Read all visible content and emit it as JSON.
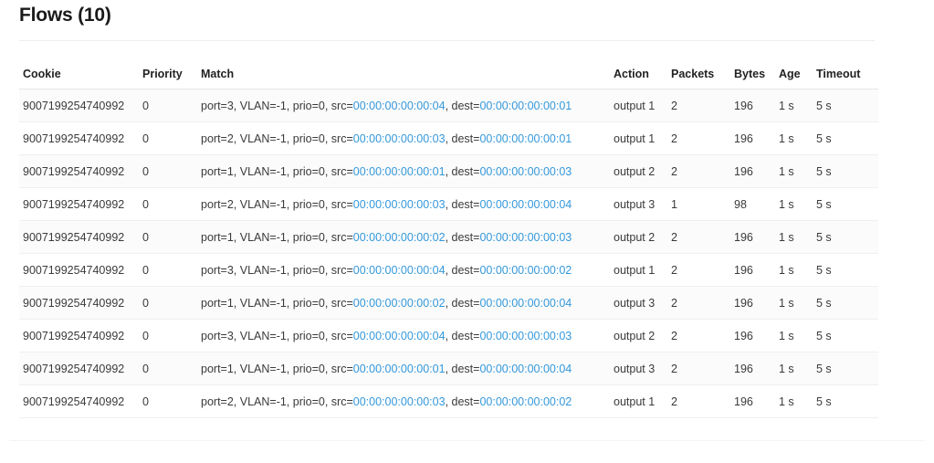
{
  "page": {
    "title": "Flows (10)"
  },
  "table": {
    "columns": [
      {
        "key": "cookie",
        "label": "Cookie"
      },
      {
        "key": "priority",
        "label": "Priority"
      },
      {
        "key": "match",
        "label": "Match"
      },
      {
        "key": "action",
        "label": "Action"
      },
      {
        "key": "packets",
        "label": "Packets"
      },
      {
        "key": "bytes",
        "label": "Bytes"
      },
      {
        "key": "age",
        "label": "Age"
      },
      {
        "key": "timeout",
        "label": "Timeout"
      }
    ],
    "rows": [
      {
        "cookie": "9007199254740992",
        "priority": "0",
        "match_prefix": "port=3, VLAN=-1, prio=0, src=",
        "match_src": "00:00:00:00:00:04",
        "match_mid": ", dest=",
        "match_dest": "00:00:00:00:00:01",
        "action": "output 1",
        "packets": "2",
        "bytes": "196",
        "age": "1 s",
        "timeout": "5 s"
      },
      {
        "cookie": "9007199254740992",
        "priority": "0",
        "match_prefix": "port=2, VLAN=-1, prio=0, src=",
        "match_src": "00:00:00:00:00:03",
        "match_mid": ", dest=",
        "match_dest": "00:00:00:00:00:01",
        "action": "output 1",
        "packets": "2",
        "bytes": "196",
        "age": "1 s",
        "timeout": "5 s"
      },
      {
        "cookie": "9007199254740992",
        "priority": "0",
        "match_prefix": "port=1, VLAN=-1, prio=0, src=",
        "match_src": "00:00:00:00:00:01",
        "match_mid": ", dest=",
        "match_dest": "00:00:00:00:00:03",
        "action": "output 2",
        "packets": "2",
        "bytes": "196",
        "age": "1 s",
        "timeout": "5 s"
      },
      {
        "cookie": "9007199254740992",
        "priority": "0",
        "match_prefix": "port=2, VLAN=-1, prio=0, src=",
        "match_src": "00:00:00:00:00:03",
        "match_mid": ", dest=",
        "match_dest": "00:00:00:00:00:04",
        "action": "output 3",
        "packets": "1",
        "bytes": "98",
        "age": "1 s",
        "timeout": "5 s"
      },
      {
        "cookie": "9007199254740992",
        "priority": "0",
        "match_prefix": "port=1, VLAN=-1, prio=0, src=",
        "match_src": "00:00:00:00:00:02",
        "match_mid": ", dest=",
        "match_dest": "00:00:00:00:00:03",
        "action": "output 2",
        "packets": "2",
        "bytes": "196",
        "age": "1 s",
        "timeout": "5 s"
      },
      {
        "cookie": "9007199254740992",
        "priority": "0",
        "match_prefix": "port=3, VLAN=-1, prio=0, src=",
        "match_src": "00:00:00:00:00:04",
        "match_mid": ", dest=",
        "match_dest": "00:00:00:00:00:02",
        "action": "output 1",
        "packets": "2",
        "bytes": "196",
        "age": "1 s",
        "timeout": "5 s"
      },
      {
        "cookie": "9007199254740992",
        "priority": "0",
        "match_prefix": "port=1, VLAN=-1, prio=0, src=",
        "match_src": "00:00:00:00:00:02",
        "match_mid": ", dest=",
        "match_dest": "00:00:00:00:00:04",
        "action": "output 3",
        "packets": "2",
        "bytes": "196",
        "age": "1 s",
        "timeout": "5 s"
      },
      {
        "cookie": "9007199254740992",
        "priority": "0",
        "match_prefix": "port=3, VLAN=-1, prio=0, src=",
        "match_src": "00:00:00:00:00:04",
        "match_mid": ", dest=",
        "match_dest": "00:00:00:00:00:03",
        "action": "output 2",
        "packets": "2",
        "bytes": "196",
        "age": "1 s",
        "timeout": "5 s"
      },
      {
        "cookie": "9007199254740992",
        "priority": "0",
        "match_prefix": "port=1, VLAN=-1, prio=0, src=",
        "match_src": "00:00:00:00:00:01",
        "match_mid": ", dest=",
        "match_dest": "00:00:00:00:00:04",
        "action": "output 3",
        "packets": "2",
        "bytes": "196",
        "age": "1 s",
        "timeout": "5 s"
      },
      {
        "cookie": "9007199254740992",
        "priority": "0",
        "match_prefix": "port=2, VLAN=-1, prio=0, src=",
        "match_src": "00:00:00:00:00:03",
        "match_mid": ", dest=",
        "match_dest": "00:00:00:00:00:02",
        "action": "output 1",
        "packets": "2",
        "bytes": "196",
        "age": "1 s",
        "timeout": "5 s"
      }
    ]
  },
  "colors": {
    "mac_link": "#3498db",
    "text": "#3a3a3a",
    "header_text": "#222222",
    "row_stripe": "#fbfbfb",
    "row_border": "#efefef",
    "header_border": "#e6e6e6"
  }
}
